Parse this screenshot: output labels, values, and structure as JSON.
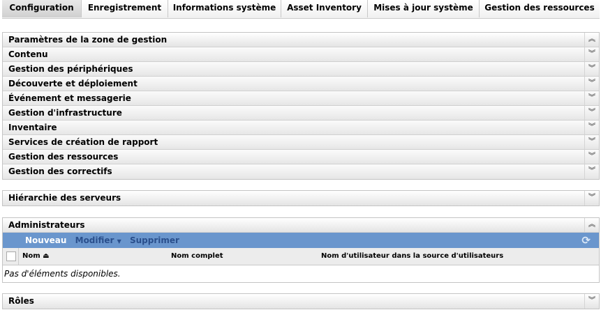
{
  "tabs": [
    "Configuration",
    "Enregistrement",
    "Informations système",
    "Asset Inventory",
    "Mises à jour système",
    "Gestion des ressources"
  ],
  "zone": {
    "title": "Paramètres de la zone de gestion",
    "items": [
      "Contenu",
      "Gestion des périphériques",
      "Découverte et déploiement",
      "Événement et messagerie",
      "Gestion d'infrastructure",
      "Inventaire",
      "Services de création de rapport",
      "Gestion des ressources",
      "Gestion des correctifs"
    ]
  },
  "hierarchy": {
    "title": "Hiérarchie des serveurs"
  },
  "admins": {
    "title": "Administrateurs",
    "toolbar": {
      "new": "Nouveau",
      "modify": "Modifier",
      "delete": "Supprimer"
    },
    "columns": [
      "Nom",
      "Nom complet",
      "Nom d'utilisateur dans la source d'utilisateurs"
    ],
    "empty": "Pas d'éléments disponibles."
  },
  "roles": {
    "title": "Rôles"
  }
}
